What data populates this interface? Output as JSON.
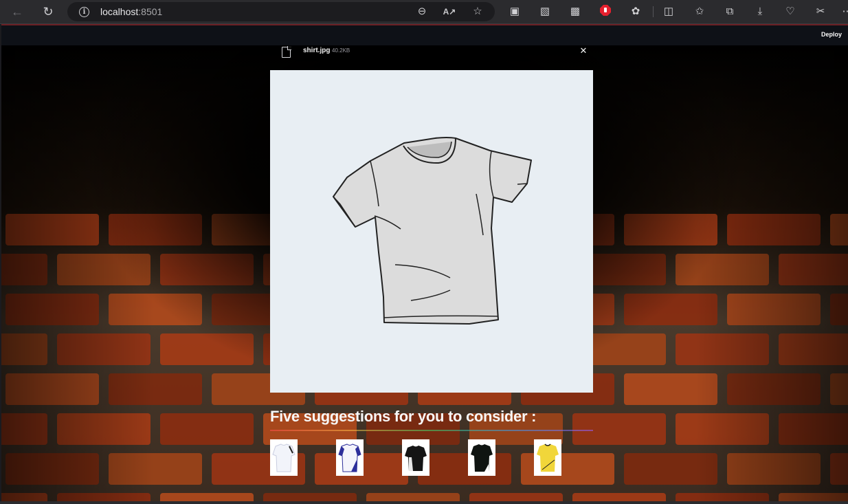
{
  "browser": {
    "url_host": "localhost",
    "url_port": ":8501"
  },
  "app": {
    "deploy_label": "Deploy",
    "uploaded_file": {
      "name": "shirt.jpg",
      "size": "40.2KB"
    },
    "suggestions_heading": "Five suggestions for you to consider :",
    "suggestions": [
      {
        "color": "white"
      },
      {
        "color": "white-blue"
      },
      {
        "color": "black-white"
      },
      {
        "color": "black"
      },
      {
        "color": "yellow"
      }
    ]
  }
}
